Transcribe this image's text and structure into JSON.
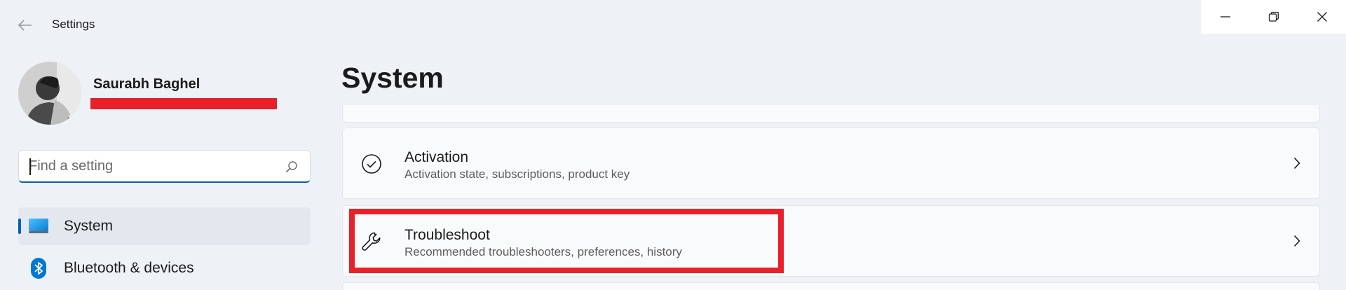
{
  "window": {
    "title": "Settings",
    "controls": [
      "minimize",
      "maximize",
      "close"
    ]
  },
  "profile": {
    "name": "Saurabh Baghel"
  },
  "search": {
    "placeholder": "Find a setting",
    "value": ""
  },
  "sidebar": {
    "items": [
      {
        "label": "System",
        "icon": "system-display-icon",
        "selected": true
      },
      {
        "label": "Bluetooth & devices",
        "icon": "bluetooth-icon",
        "selected": false
      }
    ]
  },
  "main": {
    "page_title": "System",
    "cards": [
      {
        "title": "Activation",
        "subtitle": "Activation state, subscriptions, product key",
        "icon": "checkmark-circle-icon"
      },
      {
        "title": "Troubleshoot",
        "subtitle": "Recommended troubleshooters, preferences, history",
        "icon": "wrench-icon"
      }
    ]
  },
  "colors": {
    "accent": "#005fb8",
    "highlight": "#e8202a",
    "background": "#eef2f7"
  }
}
